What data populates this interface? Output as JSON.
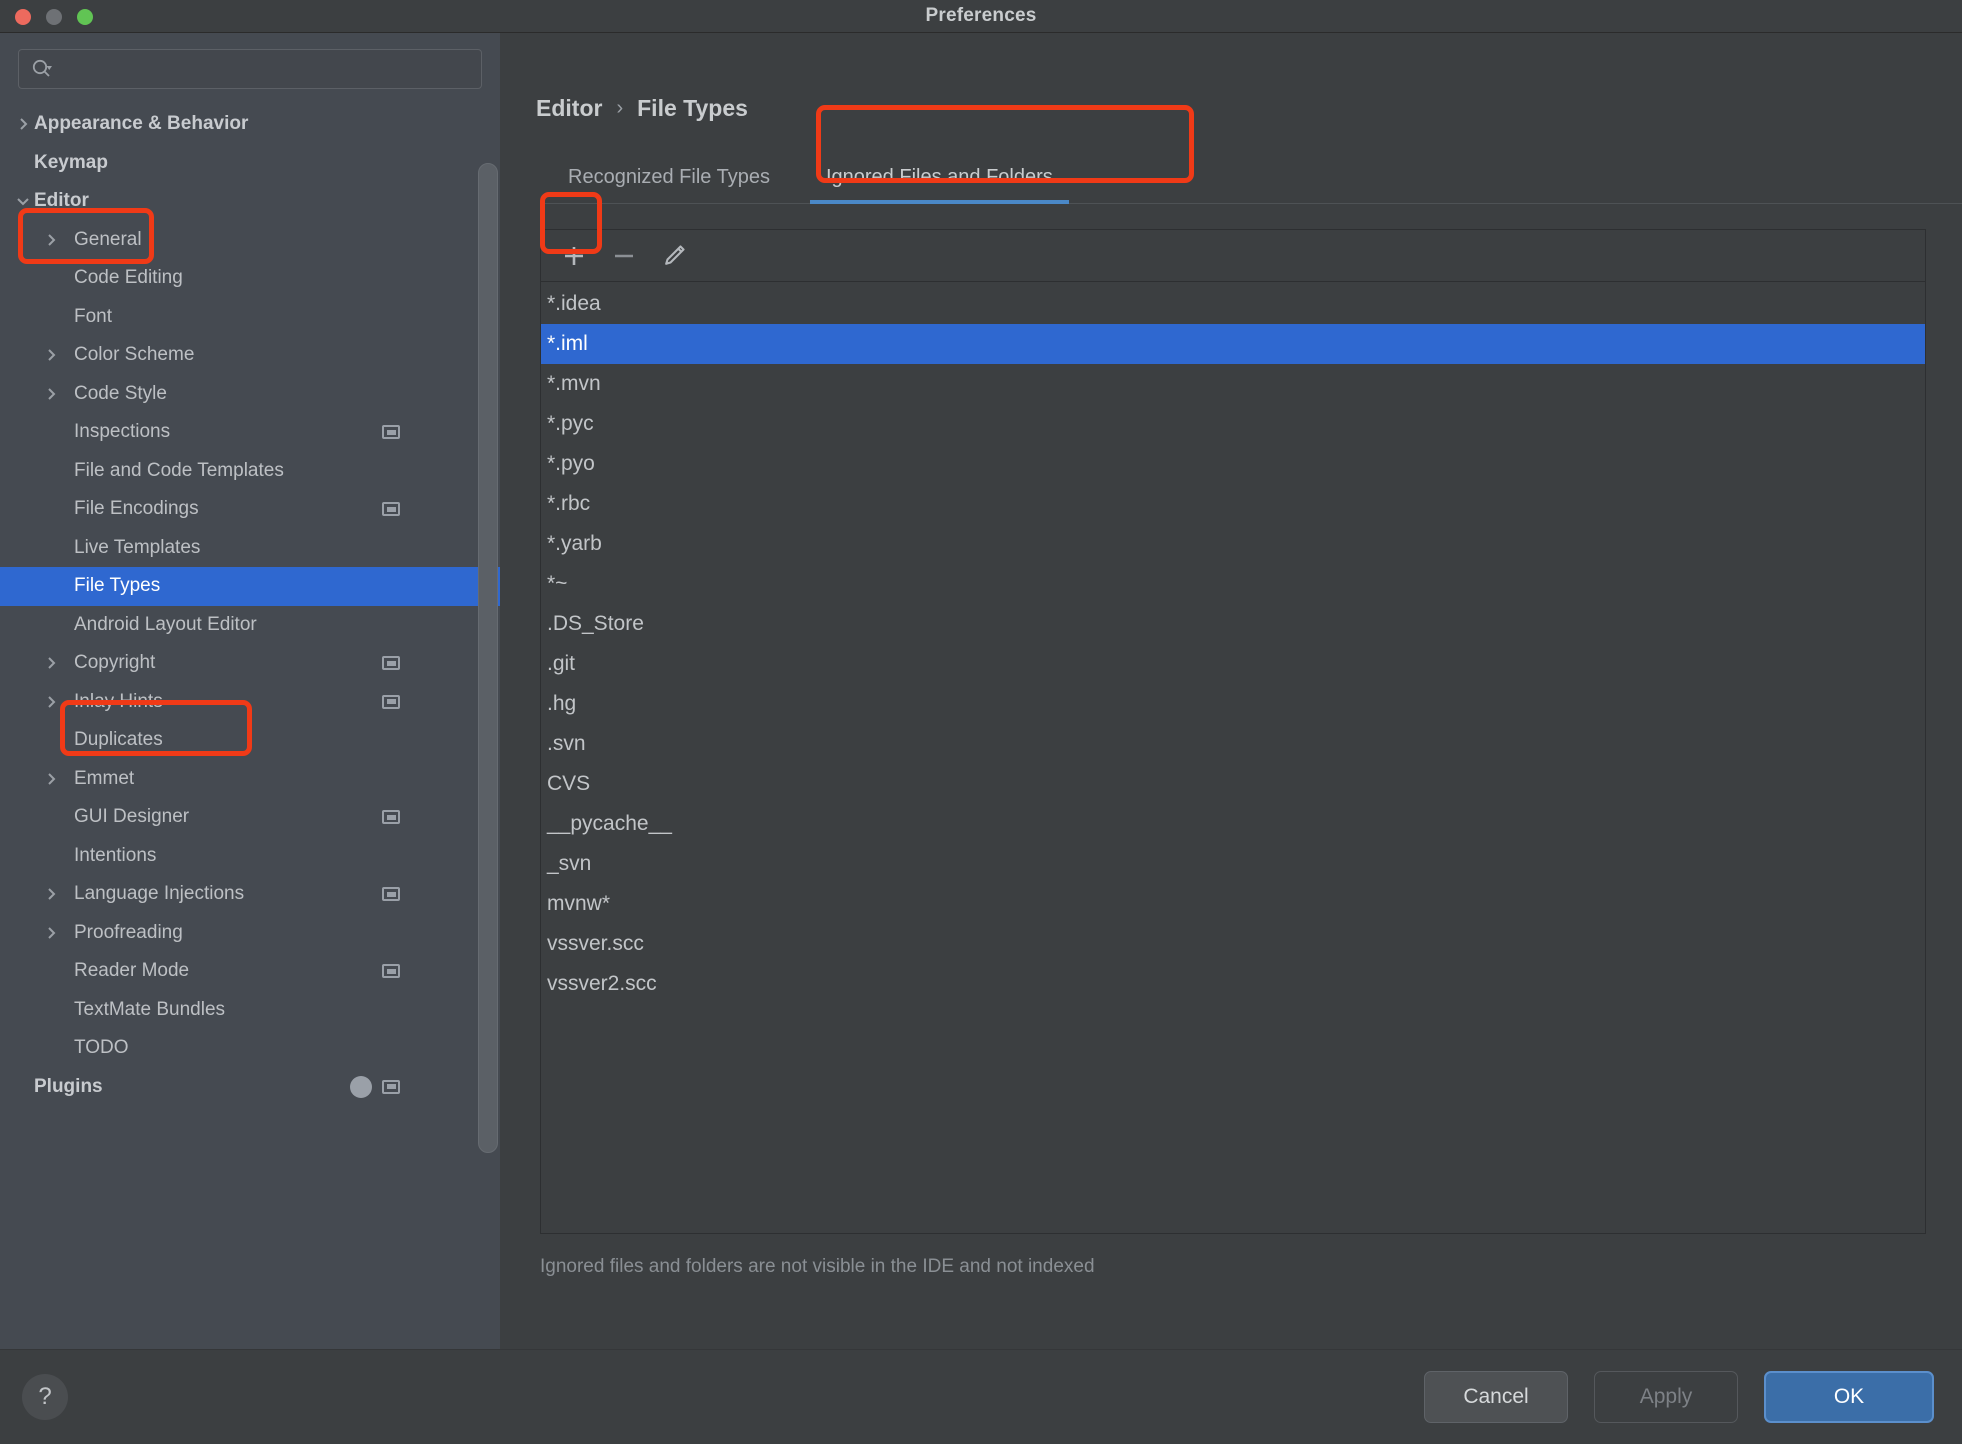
{
  "window": {
    "title": "Preferences",
    "traffic_lights": [
      "close-button",
      "minimize-button",
      "zoom-button"
    ]
  },
  "sidebar": {
    "search": {
      "value": "",
      "placeholder": "",
      "icon": "search-icon"
    },
    "items": [
      {
        "label": "Appearance & Behavior",
        "depth": 0,
        "chevron": "right",
        "bold": true,
        "selected": false,
        "badge": false
      },
      {
        "label": "Keymap",
        "depth": 0,
        "chevron": "none",
        "bold": true,
        "selected": false,
        "badge": false
      },
      {
        "label": "Editor",
        "depth": 0,
        "chevron": "down",
        "bold": true,
        "selected": false,
        "badge": false
      },
      {
        "label": "General",
        "depth": 1,
        "chevron": "right",
        "bold": false,
        "selected": false,
        "badge": false
      },
      {
        "label": "Code Editing",
        "depth": 1,
        "chevron": "none",
        "bold": false,
        "selected": false,
        "badge": false
      },
      {
        "label": "Font",
        "depth": 1,
        "chevron": "none",
        "bold": false,
        "selected": false,
        "badge": false
      },
      {
        "label": "Color Scheme",
        "depth": 1,
        "chevron": "right",
        "bold": false,
        "selected": false,
        "badge": false
      },
      {
        "label": "Code Style",
        "depth": 1,
        "chevron": "right",
        "bold": false,
        "selected": false,
        "badge": false
      },
      {
        "label": "Inspections",
        "depth": 1,
        "chevron": "none",
        "bold": false,
        "selected": false,
        "badge": true
      },
      {
        "label": "File and Code Templates",
        "depth": 1,
        "chevron": "none",
        "bold": false,
        "selected": false,
        "badge": false
      },
      {
        "label": "File Encodings",
        "depth": 1,
        "chevron": "none",
        "bold": false,
        "selected": false,
        "badge": true
      },
      {
        "label": "Live Templates",
        "depth": 1,
        "chevron": "none",
        "bold": false,
        "selected": false,
        "badge": false
      },
      {
        "label": "File Types",
        "depth": 1,
        "chevron": "none",
        "bold": false,
        "selected": true,
        "badge": false
      },
      {
        "label": "Android Layout Editor",
        "depth": 1,
        "chevron": "none",
        "bold": false,
        "selected": false,
        "badge": false
      },
      {
        "label": "Copyright",
        "depth": 1,
        "chevron": "right",
        "bold": false,
        "selected": false,
        "badge": true
      },
      {
        "label": "Inlay Hints",
        "depth": 1,
        "chevron": "right",
        "bold": false,
        "selected": false,
        "badge": true
      },
      {
        "label": "Duplicates",
        "depth": 1,
        "chevron": "none",
        "bold": false,
        "selected": false,
        "badge": false
      },
      {
        "label": "Emmet",
        "depth": 1,
        "chevron": "right",
        "bold": false,
        "selected": false,
        "badge": false
      },
      {
        "label": "GUI Designer",
        "depth": 1,
        "chevron": "none",
        "bold": false,
        "selected": false,
        "badge": true
      },
      {
        "label": "Intentions",
        "depth": 1,
        "chevron": "none",
        "bold": false,
        "selected": false,
        "badge": false
      },
      {
        "label": "Language Injections",
        "depth": 1,
        "chevron": "right",
        "bold": false,
        "selected": false,
        "badge": true
      },
      {
        "label": "Proofreading",
        "depth": 1,
        "chevron": "right",
        "bold": false,
        "selected": false,
        "badge": false
      },
      {
        "label": "Reader Mode",
        "depth": 1,
        "chevron": "none",
        "bold": false,
        "selected": false,
        "badge": true
      },
      {
        "label": "TextMate Bundles",
        "depth": 1,
        "chevron": "none",
        "bold": false,
        "selected": false,
        "badge": false
      },
      {
        "label": "TODO",
        "depth": 1,
        "chevron": "none",
        "bold": false,
        "selected": false,
        "badge": false
      },
      {
        "label": "Plugins",
        "depth": 0,
        "chevron": "none",
        "bold": true,
        "selected": false,
        "badge": true,
        "circle_badge": true
      }
    ]
  },
  "breadcrumb": {
    "parent": "Editor",
    "separator": "›",
    "current": "File Types"
  },
  "tabs": [
    {
      "label": "Recognized File Types",
      "active": false
    },
    {
      "label": "Ignored Files and Folders",
      "active": true
    }
  ],
  "toolbar": {
    "add_label": "+",
    "remove_label": "−",
    "edit_icon": "pencil-icon"
  },
  "file_list": {
    "items": [
      {
        "name": "*.idea",
        "selected": false
      },
      {
        "name": "*.iml",
        "selected": true
      },
      {
        "name": "*.mvn",
        "selected": false
      },
      {
        "name": "*.pyc",
        "selected": false
      },
      {
        "name": "*.pyo",
        "selected": false
      },
      {
        "name": "*.rbc",
        "selected": false
      },
      {
        "name": "*.yarb",
        "selected": false
      },
      {
        "name": "*~",
        "selected": false
      },
      {
        "name": ".DS_Store",
        "selected": false
      },
      {
        "name": ".git",
        "selected": false
      },
      {
        "name": ".hg",
        "selected": false
      },
      {
        "name": ".svn",
        "selected": false
      },
      {
        "name": "CVS",
        "selected": false
      },
      {
        "name": "__pycache__",
        "selected": false
      },
      {
        "name": "_svn",
        "selected": false
      },
      {
        "name": "mvnw*",
        "selected": false
      },
      {
        "name": "vssver.scc",
        "selected": false
      },
      {
        "name": "vssver2.scc",
        "selected": false
      }
    ]
  },
  "hint_text": "Ignored files and folders are not visible in the IDE and not indexed",
  "footer": {
    "help_label": "?",
    "cancel_label": "Cancel",
    "apply_label": "Apply",
    "ok_label": "OK"
  },
  "annotation_color": "#f03a17",
  "accent_color": "#2f68d0"
}
